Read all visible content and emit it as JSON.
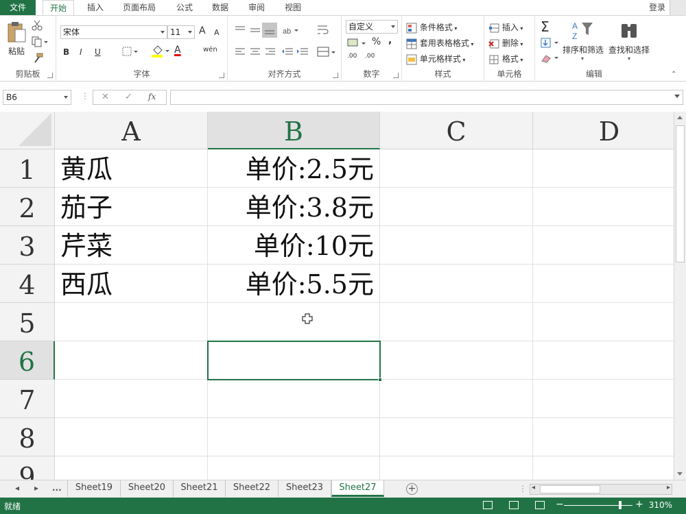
{
  "ribbon_tabs": [
    "文件",
    "开始",
    "插入",
    "页面布局",
    "公式",
    "数据",
    "审阅",
    "视图"
  ],
  "active_tab": "开始",
  "login": "登录",
  "clipboard": {
    "paste": "粘贴",
    "group": "剪贴板"
  },
  "font": {
    "name": "宋体",
    "size": "11",
    "group": "字体",
    "bold": "B",
    "italic": "I",
    "underline": "U",
    "grow": "A",
    "shrink": "A",
    "wen": "wén",
    "color_letter": "A"
  },
  "alignment": {
    "group": "对齐方式"
  },
  "number": {
    "format": "自定义",
    "group": "数字",
    "percent": "%",
    "comma": ",",
    "inc_dec": ".00",
    "dec_dec": ".00"
  },
  "styles": {
    "conditional": "条件格式",
    "table": "套用表格格式",
    "cell": "单元格样式",
    "group": "样式"
  },
  "cells": {
    "insert": "插入",
    "delete": "删除",
    "format": "格式",
    "group": "单元格"
  },
  "editing": {
    "sigma": "Σ",
    "sort": "排序和筛选",
    "find": "查找和选择",
    "group": "编辑"
  },
  "formula_bar": {
    "name_box": "B6",
    "fx": "fx",
    "content": ""
  },
  "columns": [
    "A",
    "B",
    "C",
    "D"
  ],
  "rows": [
    "1",
    "2",
    "3",
    "4",
    "5",
    "6",
    "7",
    "8",
    "9"
  ],
  "cells_data": {
    "A1": "黄瓜",
    "B1": "单价:2.5元",
    "A2": "茄子",
    "B2": "单价:3.8元",
    "A3": "芹菜",
    "B3": "单价:10元",
    "A4": "西瓜",
    "B4": "单价:5.5元"
  },
  "selected_cell": "B6",
  "sheet_nav": {
    "ellipsis": "..."
  },
  "sheets": [
    "Sheet19",
    "Sheet20",
    "Sheet21",
    "Sheet22",
    "Sheet23",
    "Sheet27"
  ],
  "active_sheet": "Sheet27",
  "status": {
    "ready": "就绪",
    "zoom": "310%",
    "zoom_minus": "−",
    "zoom_plus": "+"
  },
  "colors": {
    "accent": "#217346"
  }
}
